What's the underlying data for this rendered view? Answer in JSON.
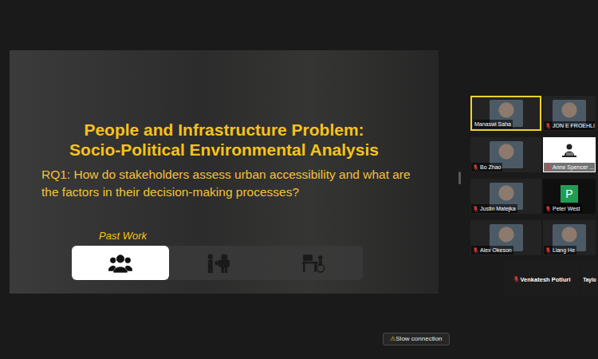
{
  "slide": {
    "title_lines": [
      "People and Infrastructure Problem:",
      "Socio-Political Environmental Analysis"
    ],
    "question": "RQ1: How do stakeholders assess urban accessibility and what are the factors in their decision-making processes?",
    "section_label": "Past Work",
    "steps": [
      {
        "kind": "people",
        "selected": true
      },
      {
        "kind": "human-robot",
        "selected": false
      },
      {
        "kind": "accessible-desk",
        "selected": false
      }
    ]
  },
  "gallery_rows": [
    [
      {
        "name": "Manaswi Saha",
        "kind": "video",
        "muted": false,
        "speaking": true
      },
      {
        "name": "JON E FROEHLI",
        "kind": "video",
        "muted": true,
        "speaking": false
      }
    ],
    [
      {
        "name": "Bo Zhao",
        "kind": "video",
        "muted": true,
        "speaking": false
      },
      {
        "name": "Anne Spencer ...",
        "kind": "picture",
        "muted": true,
        "speaking": false
      }
    ],
    [
      {
        "name": "Justin Matejka",
        "kind": "video",
        "muted": true,
        "speaking": false
      },
      {
        "name": "Peter West",
        "kind": "letter",
        "letter": "P",
        "muted": true,
        "speaking": false
      }
    ],
    [
      {
        "name": "Alex Okeson",
        "kind": "video",
        "muted": true,
        "speaking": false
      },
      {
        "name": "Liang He",
        "kind": "video",
        "muted": true,
        "speaking": false
      }
    ],
    [
      {
        "name": "Venkatesh Potluri",
        "kind": "name",
        "muted": true,
        "speaking": false
      },
      {
        "name": "Taylo",
        "kind": "name",
        "muted": true,
        "speaking": false
      }
    ]
  ],
  "status": {
    "icon": "⚠",
    "text": "Slow connection"
  }
}
